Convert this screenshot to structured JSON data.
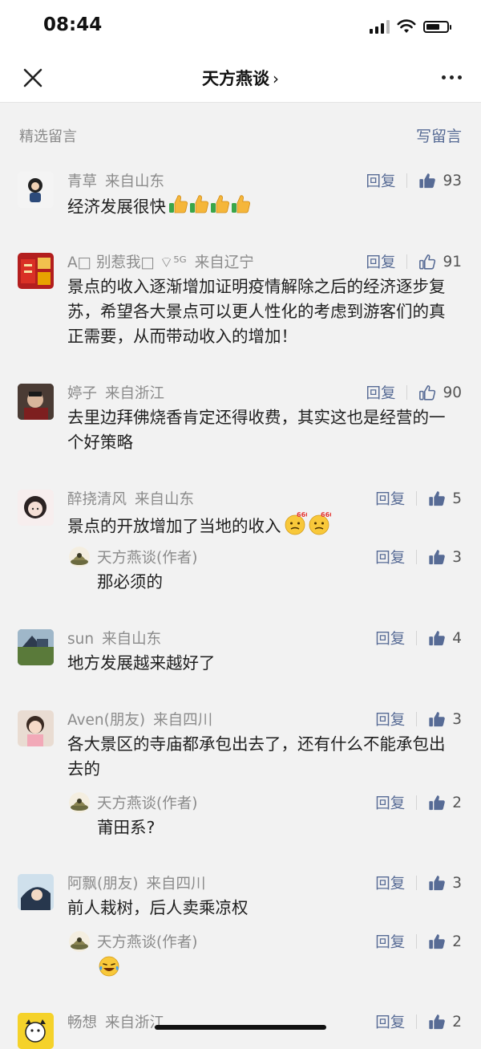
{
  "status_bar": {
    "time": "08:44"
  },
  "nav": {
    "title": "天方燕谈",
    "chevron": "›"
  },
  "section": {
    "title": "精选留言",
    "write_label": "写留言"
  },
  "reply_label": "回复",
  "comments": [
    {
      "name": "青草",
      "location": "来自山东",
      "text": "经济发展很快",
      "likes": "93",
      "liked": true
    },
    {
      "name": "A□ 别惹我□ ⌔⁵ᴳ",
      "location": "来自辽宁",
      "text": "景点的收入逐渐增加证明疫情解除之后的经济逐步复苏，希望各大景点可以更人性化的考虑到游客们的真正需要，从而带动收入的增加！",
      "likes": "91",
      "liked": false
    },
    {
      "name": "婷子",
      "location": "来自浙江",
      "text": "去里边拜佛烧香肯定还得收费，其实这也是经营的一个好策略",
      "likes": "90",
      "liked": false
    },
    {
      "name": "醉挠清风",
      "location": "来自山东",
      "text": "景点的开放增加了当地的收入",
      "likes": "5",
      "liked": true,
      "reply": {
        "name": "天方燕谈(作者)",
        "text": "那必须的",
        "likes": "3"
      }
    },
    {
      "name": "sun",
      "location": "来自山东",
      "text": "地方发展越来越好了",
      "likes": "4",
      "liked": true
    },
    {
      "name": "Aven(朋友)",
      "location": "来自四川",
      "text": "各大景区的寺庙都承包出去了，还有什么不能承包出去的",
      "likes": "3",
      "liked": true,
      "reply": {
        "name": "天方燕谈(作者)",
        "text": "莆田系?",
        "likes": "2"
      }
    },
    {
      "name": "阿飘(朋友)",
      "location": "来自四川",
      "text": "前人栽树，后人卖乘凉权",
      "likes": "3",
      "liked": true,
      "reply": {
        "name": "天方燕谈(作者)",
        "text": "",
        "likes": "2"
      }
    },
    {
      "name": "畅想",
      "location": "来自浙江",
      "text": "",
      "likes": "2",
      "liked": true
    }
  ]
}
